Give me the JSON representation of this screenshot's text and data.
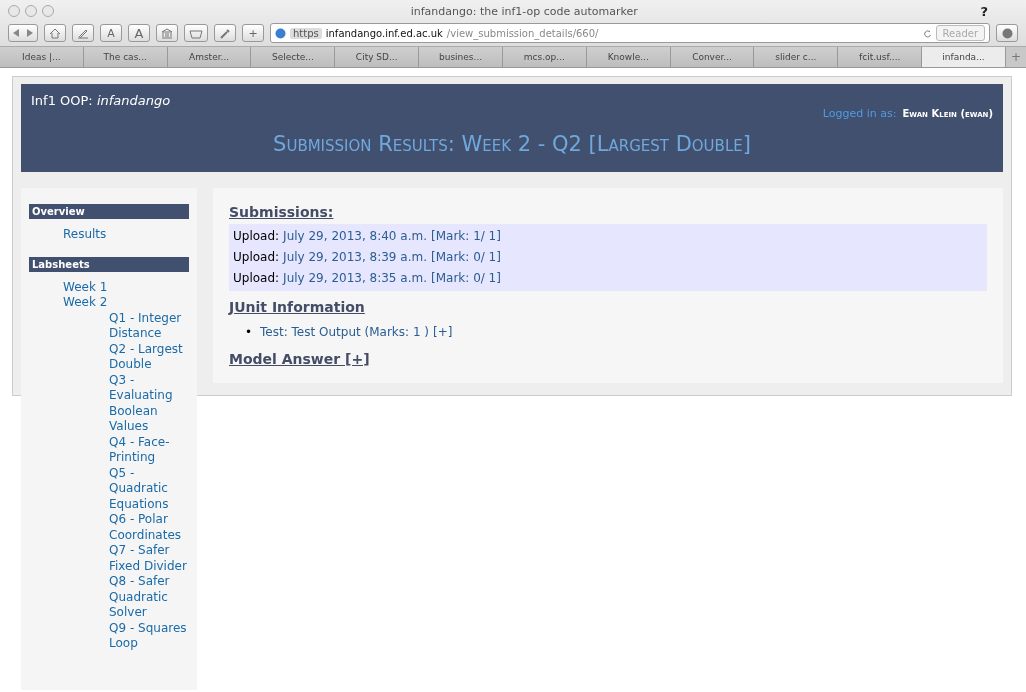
{
  "window": {
    "title": "infandango: the inf1-op code automarker",
    "help": "?"
  },
  "toolbar": {
    "font_small": "A",
    "font_large": "A",
    "add": "+",
    "url_scheme": "https",
    "url_host": "infandango.inf.ed.ac.uk",
    "url_path": "/view_submission_details/660/",
    "reader": "Reader"
  },
  "tabs": [
    {
      "label": "Ideas |...",
      "selected": false
    },
    {
      "label": "The cas...",
      "selected": false
    },
    {
      "label": "Amster...",
      "selected": false
    },
    {
      "label": "Selecte...",
      "selected": false
    },
    {
      "label": "City SD...",
      "selected": false
    },
    {
      "label": "busines...",
      "selected": false
    },
    {
      "label": "mcs.op...",
      "selected": false
    },
    {
      "label": "Knowle...",
      "selected": false
    },
    {
      "label": "Conver...",
      "selected": false
    },
    {
      "label": "slider c...",
      "selected": false
    },
    {
      "label": "fcit.usf....",
      "selected": false
    },
    {
      "label": "infanda...",
      "selected": true
    }
  ],
  "new_tab": "+",
  "header": {
    "site": "Inf1 OOP: ",
    "site_name": "infandango",
    "logged_in_label": "Logged in as:",
    "user": "Ewan Klein (ewan)",
    "page_title": "Submission Results: Week 2 - Q2 [Largest Double]"
  },
  "sidebar": {
    "sections": [
      {
        "title": "Overview",
        "items": [
          {
            "label": "Results"
          }
        ]
      },
      {
        "title": "Labsheets",
        "items": [
          {
            "label": "Week 1"
          },
          {
            "label": "Week 2",
            "children": [
              {
                "label": "Q1 - Integer Distance"
              },
              {
                "label": "Q2 - Largest Double"
              },
              {
                "label": "Q3 - Evaluating Boolean Values"
              },
              {
                "label": "Q4 - Face-Printing"
              },
              {
                "label": "Q5 - Quadratic Equations"
              },
              {
                "label": "Q6 - Polar Coordinates"
              },
              {
                "label": "Q7 - Safer Fixed Divider"
              },
              {
                "label": "Q8 - Safer Quadratic Solver"
              },
              {
                "label": "Q9 - Squares Loop"
              }
            ]
          }
        ]
      }
    ]
  },
  "submissions": {
    "heading": "Submissions:",
    "rows": [
      {
        "label": "Upload:",
        "time": "July 29, 2013, 8:40 a.m.",
        "mark": "[Mark: 1/ 1]"
      },
      {
        "label": "Upload:",
        "time": "July 29, 2013, 8:39 a.m.",
        "mark": "[Mark: 0/ 1]"
      },
      {
        "label": "Upload:",
        "time": "July 29, 2013, 8:35 a.m.",
        "mark": "[Mark: 0/ 1]"
      }
    ]
  },
  "junit": {
    "heading": "JUnit Information",
    "tests": [
      {
        "bullet": "•",
        "text": "Test: Test Output (Marks: 1 )",
        "toggle": "[+]"
      }
    ]
  },
  "model_answer": {
    "heading": "Model Answer [+]"
  }
}
